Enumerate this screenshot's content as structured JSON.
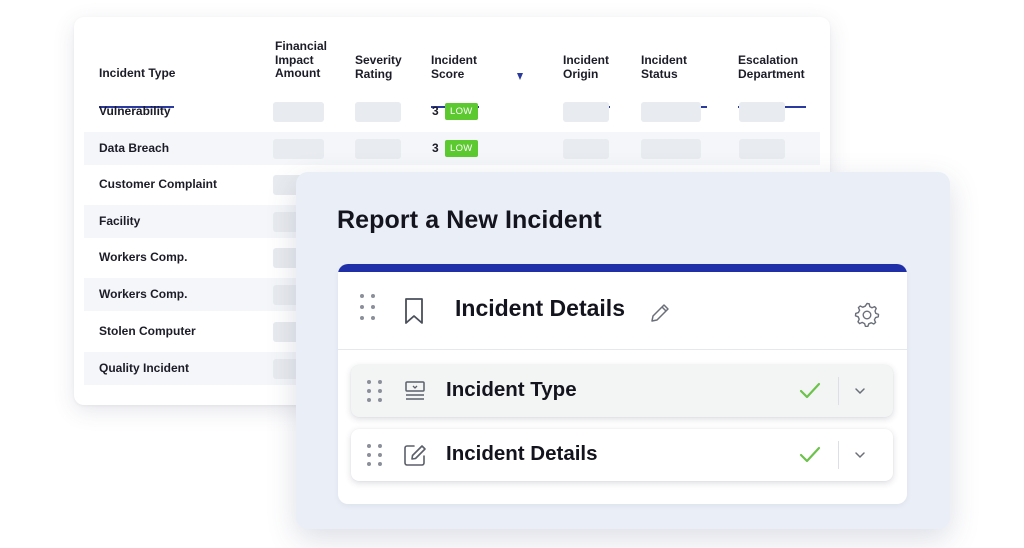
{
  "table": {
    "columns": [
      {
        "id": "incident_type",
        "lines": [
          "Incident Type"
        ]
      },
      {
        "id": "financial_impact",
        "lines": [
          "Financial",
          "Impact",
          "Amount"
        ]
      },
      {
        "id": "severity",
        "lines": [
          "Severity",
          "Rating"
        ]
      },
      {
        "id": "score",
        "lines": [
          "Incident",
          "Score"
        ]
      },
      {
        "id": "origin",
        "lines": [
          "Incident",
          "Origin"
        ]
      },
      {
        "id": "status",
        "lines": [
          "Incident",
          "Status"
        ]
      },
      {
        "id": "escalation",
        "lines": [
          "Escalation",
          "Department"
        ]
      }
    ],
    "sorted_column_icon": "caret-down-icon",
    "rows": [
      {
        "type": "Vulnerability",
        "score": "3",
        "badge": "LOW"
      },
      {
        "type": "Data Breach",
        "score": "3",
        "badge": "LOW"
      },
      {
        "type": "Customer Complaint"
      },
      {
        "type": "Facility"
      },
      {
        "type": "Workers Comp."
      },
      {
        "type": "Workers Comp."
      },
      {
        "type": "Stolen Computer"
      },
      {
        "type": "Quality Incident"
      }
    ],
    "badge_color": "#5cc930",
    "header_underline_color": "#2b3a9e"
  },
  "modal": {
    "title": "Report a New Incident",
    "accent_color": "#1f2fa8",
    "section": {
      "title": "Incident Details",
      "icons": [
        "drag-handle-icon",
        "bookmark-icon",
        "pencil-icon",
        "gear-icon"
      ]
    },
    "fields": [
      {
        "label": "Incident Type",
        "icon": "form-list-icon",
        "status_icon": "check-icon",
        "expand_icon": "chevron-down-icon"
      },
      {
        "label": "Incident Details",
        "icon": "edit-icon",
        "status_icon": "check-icon",
        "expand_icon": "chevron-down-icon"
      }
    ],
    "check_color": "#6cc24a"
  }
}
